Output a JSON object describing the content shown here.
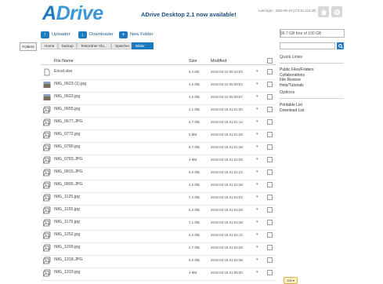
{
  "header": {
    "logo_a": "A",
    "logo_rest": "Drive",
    "promo": "ADrive Desktop 2.1 now available!",
    "last_login": "Last login : 2015-06-10 (172.91.212.30)"
  },
  "toolbar": {
    "upload": "Uploader",
    "download": "Downloader",
    "new_folder": "New Folder"
  },
  "storage": {
    "used_fraction": 0.01,
    "text": "99.7 GB free of 100 GB"
  },
  "breadcrumbs": {
    "folders_label": "Folders",
    "items": [
      "Home",
      "backup",
      "Testordner Clo...",
      "Speicher",
      "Bilder"
    ]
  },
  "table": {
    "headers": {
      "name": "File Name",
      "size": "Size",
      "modified": "Modified"
    },
    "rows": [
      {
        "name": "Excel.xlsx",
        "size": "9.4 KB",
        "modified": "2015-04-10 05:10:03",
        "type": "file"
      },
      {
        "name": "IMG_0623 (1).jpg",
        "size": "4.6 MB",
        "modified": "2015-04-10 05:09:53",
        "type": "thumb"
      },
      {
        "name": "IMG_0623.jpg",
        "size": "4.6 MB",
        "modified": "2015-04-10 05:09:57",
        "type": "thumb"
      },
      {
        "name": "IMG_0655.jpg",
        "size": "4.1 MB",
        "modified": "2015-03-19 01:01:00",
        "type": "image"
      },
      {
        "name": "IMG_0677.JPG",
        "size": "4.7 MB",
        "modified": "2015-03-19 01:01:14",
        "type": "image"
      },
      {
        "name": "IMG_0772.jpg",
        "size": "5 MB",
        "modified": "2015-03-19 01:01:28",
        "type": "image"
      },
      {
        "name": "IMG_0780.jpg",
        "size": "5.7 MB",
        "modified": "2015-03-19 01:01:48",
        "type": "image"
      },
      {
        "name": "IMG_0783.JPG",
        "size": "4 MB",
        "modified": "2015-03-19 01:02:08",
        "type": "image"
      },
      {
        "name": "IMG_0815.JPG",
        "size": "6.6 MB",
        "modified": "2015-03-19 01:02:22",
        "type": "image"
      },
      {
        "name": "IMG_0890.JPG",
        "size": "4.5 MB",
        "modified": "2015-03-19 01:02:48",
        "type": "image"
      },
      {
        "name": "IMG_1125.jpg",
        "size": "7.4 MB",
        "modified": "2015-03-19 01:03:02",
        "type": "image"
      },
      {
        "name": "IMG_1155.jpg",
        "size": "5.3 MB",
        "modified": "2015-03-19 01:03:28",
        "type": "image"
      },
      {
        "name": "IMG_1175.jpg",
        "size": "7.1 MB",
        "modified": "2015-03-19 01:03:48",
        "type": "image"
      },
      {
        "name": "IMG_1252.jpg",
        "size": "4.2 MB",
        "modified": "2015-03-19 01:04:12",
        "type": "image"
      },
      {
        "name": "IMG_1299.jpg",
        "size": "2.7 MB",
        "modified": "2015-03-19 01:04:28",
        "type": "image"
      },
      {
        "name": "IMG_1318.JPG",
        "size": "6.6 MB",
        "modified": "2015-03-19 01:04:38",
        "type": "image"
      },
      {
        "name": "IMG_1319.jpg",
        "size": "4 MB",
        "modified": "2015-03-19 01:05:00",
        "type": "image"
      }
    ]
  },
  "sidebar": {
    "quick_links_title": "Quick Links",
    "quick_links": [
      "Public Files/Folders",
      "Collaborations",
      "File Restore",
      "Help/Tutorials"
    ],
    "options_title": "Options",
    "options": [
      "Printable List",
      "Download List"
    ]
  },
  "footer": {
    "pill": "100 ▾"
  },
  "colors": {
    "brand": "#1e7ac0",
    "link": "#1e5d91"
  }
}
